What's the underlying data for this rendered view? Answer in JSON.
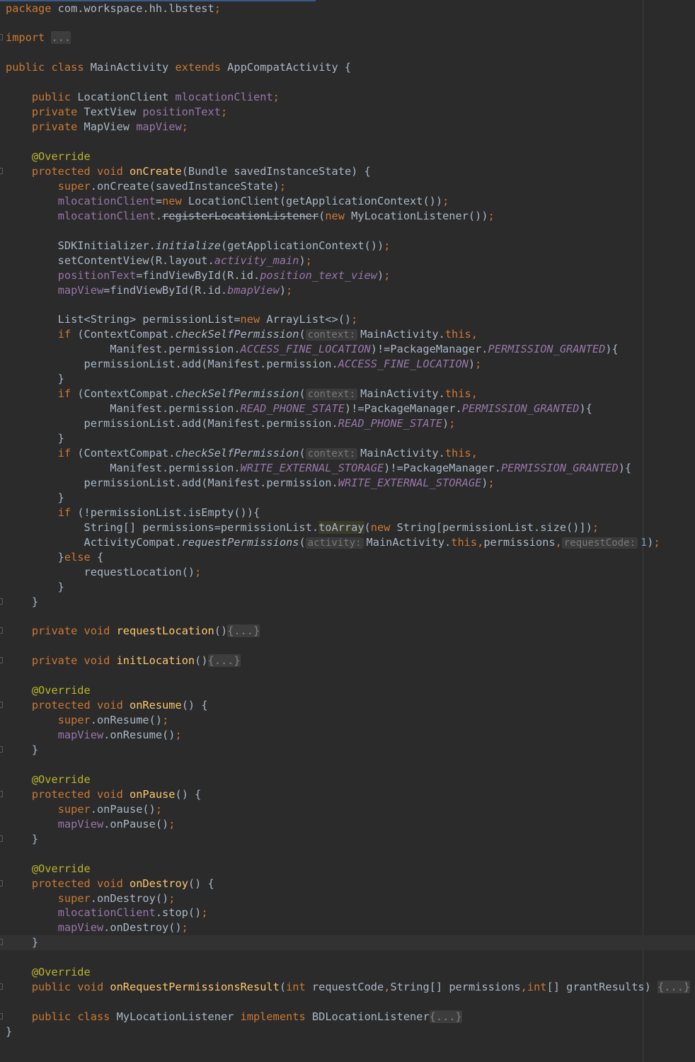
{
  "editor": {
    "theme": "darcula",
    "colors": {
      "background": "#2b2b2b",
      "keyword": "#cc7832",
      "annotation": "#bbb529",
      "field": "#9876aa",
      "method_decl": "#ffc66d",
      "number": "#6897bb",
      "default": "#a9b7c6"
    },
    "current_line": 63,
    "lines": [
      "package com.workspace.hh.lbstest;",
      "",
      "import ...",
      "",
      "public class MainActivity extends AppCompatActivity {",
      "",
      "    public LocationClient mlocationClient;",
      "    private TextView positionText;",
      "    private MapView mapView;",
      "",
      "    @Override",
      "    protected void onCreate(Bundle savedInstanceState) {",
      "        super.onCreate(savedInstanceState);",
      "        mlocationClient=new LocationClient(getApplicationContext());",
      "        mlocationClient.registerLocationListener(new MyLocationListener());",
      "",
      "        SDKInitializer.initialize(getApplicationContext());",
      "        setContentView(R.layout.activity_main);",
      "        positionText=findViewById(R.id.position_text_view);",
      "        mapView=findViewById(R.id.bmapView);",
      "",
      "        List<String> permissionList=new ArrayList<>();",
      "        if (ContextCompat.checkSelfPermission( context: MainActivity.this,",
      "                Manifest.permission.ACCESS_FINE_LOCATION)!=PackageManager.PERMISSION_GRANTED){",
      "            permissionList.add(Manifest.permission.ACCESS_FINE_LOCATION);",
      "        }",
      "        if (ContextCompat.checkSelfPermission( context: MainActivity.this,",
      "                Manifest.permission.READ_PHONE_STATE)!=PackageManager.PERMISSION_GRANTED){",
      "            permissionList.add(Manifest.permission.READ_PHONE_STATE);",
      "        }",
      "        if (ContextCompat.checkSelfPermission( context: MainActivity.this,",
      "                Manifest.permission.WRITE_EXTERNAL_STORAGE)!=PackageManager.PERMISSION_GRANTED){",
      "            permissionList.add(Manifest.permission.WRITE_EXTERNAL_STORAGE);",
      "        }",
      "        if (!permissionList.isEmpty()){",
      "            String[] permissions=permissionList.toArray(new String[permissionList.size()]);",
      "            ActivityCompat.requestPermissions( activity: MainActivity.this,permissions, requestCode: 1);",
      "        }else {",
      "            requestLocation();",
      "        }",
      "    }",
      "",
      "    private void requestLocation(){...}",
      "",
      "    private void initLocation(){...}",
      "",
      "    @Override",
      "    protected void onResume() {",
      "        super.onResume();",
      "        mapView.onResume();",
      "    }",
      "",
      "    @Override",
      "    protected void onPause() {",
      "        super.onPause();",
      "        mapView.onPause();",
      "    }",
      "",
      "    @Override",
      "    protected void onDestroy() {",
      "        super.onDestroy();",
      "        mlocationClient.stop();",
      "        mapView.onDestroy();",
      "    }",
      "",
      "    @Override",
      "    public void onRequestPermissionsResult(int requestCode,String[] permissions,int[] grantResults) {...}",
      "",
      "    public class MyLocationListener implements BDLocationListener{...}",
      "}"
    ]
  }
}
